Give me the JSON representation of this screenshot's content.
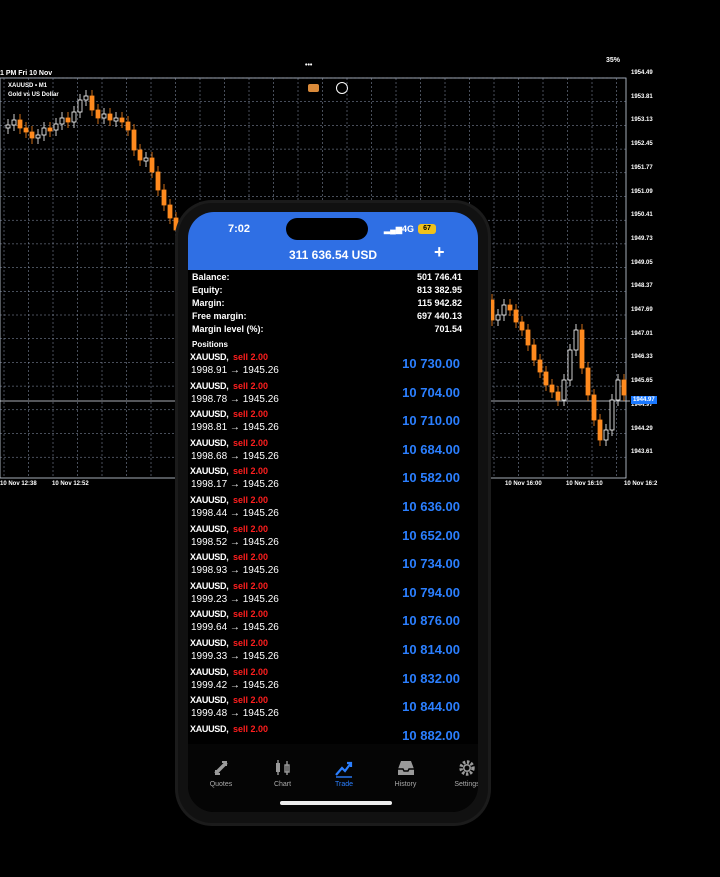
{
  "tablet": {
    "status_left": "1 PM  Fri 10 Nov",
    "status_right": "35%",
    "symbol": "XAUUSD • M1",
    "description": "Gold vs US Dollar",
    "price_axis": [
      "1954.49",
      "1953.81",
      "1953.13",
      "1952.45",
      "1951.77",
      "1951.09",
      "1950.41",
      "1949.73",
      "1949.05",
      "1948.37",
      "1947.69",
      "1947.01",
      "1946.33",
      "1945.65",
      "1944.97",
      "1944.29",
      "1943.61"
    ],
    "current_price": "1944.97",
    "time_axis": [
      "10 Nov 12:38",
      "10 Nov 12:52",
      "10 Nov 16:00",
      "10 Nov 16:10",
      "10 Nov 16:2"
    ]
  },
  "phone": {
    "status": {
      "time": "7:02",
      "network": "4G",
      "battery": "67"
    },
    "header": {
      "total": "311 636.54 USD",
      "add_label": "+"
    },
    "summary": [
      {
        "label": "Balance:",
        "value": "501 746.41"
      },
      {
        "label": "Equity:",
        "value": "813 382.95"
      },
      {
        "label": "Margin:",
        "value": "115 942.82"
      },
      {
        "label": "Free margin:",
        "value": "697 440.13"
      },
      {
        "label": "Margin level (%):",
        "value": "701.54"
      }
    ],
    "positions_title": "Positions",
    "positions": [
      {
        "symbol": "XAUUSD,",
        "direction": "sell 2.00",
        "prices": "1998.91 → 1945.26",
        "profit": "10 730.00"
      },
      {
        "symbol": "XAUUSD,",
        "direction": "sell 2.00",
        "prices": "1998.78 → 1945.26",
        "profit": "10 704.00"
      },
      {
        "symbol": "XAUUSD,",
        "direction": "sell 2.00",
        "prices": "1998.81 → 1945.26",
        "profit": "10 710.00"
      },
      {
        "symbol": "XAUUSD,",
        "direction": "sell 2.00",
        "prices": "1998.68 → 1945.26",
        "profit": "10 684.00"
      },
      {
        "symbol": "XAUUSD,",
        "direction": "sell 2.00",
        "prices": "1998.17 → 1945.26",
        "profit": "10 582.00"
      },
      {
        "symbol": "XAUUSD,",
        "direction": "sell 2.00",
        "prices": "1998.44 → 1945.26",
        "profit": "10 636.00"
      },
      {
        "symbol": "XAUUSD,",
        "direction": "sell 2.00",
        "prices": "1998.52 → 1945.26",
        "profit": "10 652.00"
      },
      {
        "symbol": "XAUUSD,",
        "direction": "sell 2.00",
        "prices": "1998.93 → 1945.26",
        "profit": "10 734.00"
      },
      {
        "symbol": "XAUUSD,",
        "direction": "sell 2.00",
        "prices": "1999.23 → 1945.26",
        "profit": "10 794.00"
      },
      {
        "symbol": "XAUUSD,",
        "direction": "sell 2.00",
        "prices": "1999.64 → 1945.26",
        "profit": "10 876.00"
      },
      {
        "symbol": "XAUUSD,",
        "direction": "sell 2.00",
        "prices": "1999.33 → 1945.26",
        "profit": "10 814.00"
      },
      {
        "symbol": "XAUUSD,",
        "direction": "sell 2.00",
        "prices": "1999.42 → 1945.26",
        "profit": "10 832.00"
      },
      {
        "symbol": "XAUUSD,",
        "direction": "sell 2.00",
        "prices": "1999.48 → 1945.26",
        "profit": "10 844.00"
      },
      {
        "symbol": "XAUUSD,",
        "direction": "sell 2.00",
        "prices": "",
        "profit": "10 882.00"
      }
    ],
    "tabs": [
      {
        "label": "Quotes",
        "icon": "quotes-icon"
      },
      {
        "label": "Chart",
        "icon": "chart-icon"
      },
      {
        "label": "Trade",
        "icon": "trade-icon",
        "active": true
      },
      {
        "label": "History",
        "icon": "history-icon"
      },
      {
        "label": "Settings",
        "icon": "settings-icon"
      }
    ],
    "colors": {
      "header": "#2f6fe4",
      "profit": "#2b7fff",
      "sell": "#ff1e1e",
      "candle_up": "#ffffff",
      "candle_down": "#ff8a1e"
    }
  }
}
